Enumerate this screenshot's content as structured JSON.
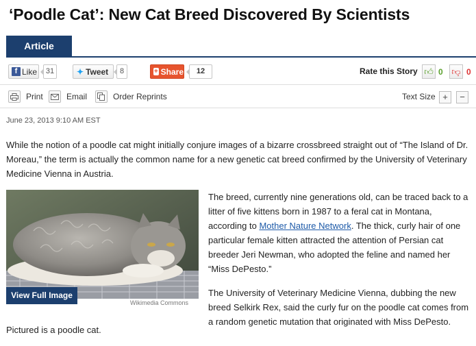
{
  "headline": "‘Poodle Cat’: New Cat Breed Discovered By Scientists",
  "tabs": {
    "article": "Article"
  },
  "share": {
    "facebook_label": "Like",
    "facebook_count": "31",
    "twitter_label": "Tweet",
    "twitter_count": "8",
    "share_label": "Share",
    "share_count": "12",
    "rate_label": "Rate this Story",
    "thumbs_up_count": "0",
    "thumbs_down_count": "0"
  },
  "tools": {
    "print": "Print",
    "email": "Email",
    "reprints": "Order Reprints",
    "text_size": "Text Size",
    "plus": "+",
    "minus": "−"
  },
  "dateline": "June 23, 2013 9:10 AM EST",
  "paragraph1": "While the notion of a poodle cat might initially conjure images of a bizarre crossbreed straight out of “The Island of Dr. Moreau,” the term is actually the common name for a new genetic cat breed confirmed by the University of Veterinary Medicine Vienna in Austria.",
  "image": {
    "view_full": "View Full Image",
    "credit": "Wikimedia Commons",
    "caption": "Pictured is a poodle cat."
  },
  "paragraph2": {
    "before_link": "The breed, currently nine generations old, can be traced back to a litter of five kittens born in 1987 to a feral cat in Montana, according to ",
    "link": "Mother Nature Network",
    "after_link": ". The thick, curly hair of one particular female kitten attracted the attention of Persian cat breeder Jeri Newman, who adopted the feline and named her “Miss DePesto.”"
  },
  "paragraph3": "The University of Veterinary Medicine Vienna, dubbing the new breed Selkirk Rex, said the curly fur on the poodle cat comes from a random genetic mutation that originated with Miss DePesto.",
  "colors": {
    "brand_navy": "#1c3f6e",
    "share_orange": "#e7542e",
    "link_blue": "#1d5aa8",
    "thumb_green": "#5aa02c",
    "thumb_red": "#dd3333"
  }
}
